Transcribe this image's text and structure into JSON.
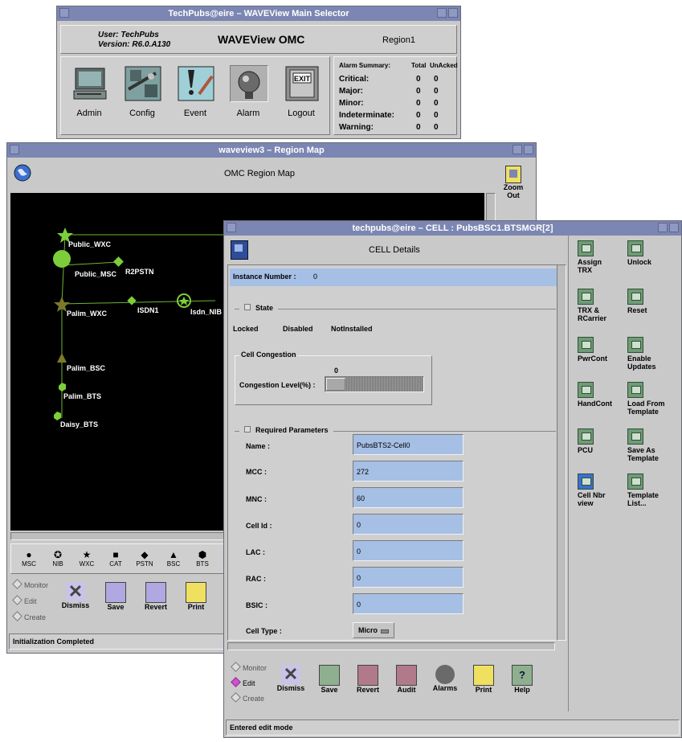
{
  "main_selector": {
    "title": "TechPubs@eire – WAVEView Main Selector",
    "user": "User: TechPubs",
    "version": "Version: R6.0.A130",
    "app_title": "WAVEView OMC",
    "region": "Region1",
    "tools": [
      {
        "label": "Admin",
        "icon": "computer-icon"
      },
      {
        "label": "Config",
        "icon": "config-icon"
      },
      {
        "label": "Event",
        "icon": "event-icon"
      },
      {
        "label": "Alarm",
        "icon": "alarm-bell-icon"
      },
      {
        "label": "Logout",
        "icon": "exit-door-icon",
        "icon_text": "EXIT"
      }
    ],
    "alarm_summary": {
      "header": "Alarm Summary:",
      "col_total": "Total",
      "col_unacked": "UnAcked",
      "rows": [
        {
          "label": "Critical:",
          "total": "0",
          "unacked": "0"
        },
        {
          "label": "Major:",
          "total": "0",
          "unacked": "0"
        },
        {
          "label": "Minor:",
          "total": "0",
          "unacked": "0"
        },
        {
          "label": "Indeterminate:",
          "total": "0",
          "unacked": "0"
        },
        {
          "label": "Warning:",
          "total": "0",
          "unacked": "0"
        }
      ]
    }
  },
  "region_map": {
    "title": "waveview3 – Region Map",
    "header": "OMC Region Map",
    "zoom_out_label": "Zoom\nOut",
    "nodes": {
      "public_wxc": "Public_WXC",
      "public_msc": "Public_MSC",
      "r2pstn": "R2PSTN",
      "palim_wxc": "Palim_WXC",
      "isdn1": "ISDN1",
      "isdn_nib": "Isdn_NIB",
      "palim_bsc": "Palim_BSC",
      "palim_bts": "Palim_BTS",
      "daisy_bts": "Daisy_BTS"
    },
    "legend": [
      {
        "sym": "●",
        "label": "MSC"
      },
      {
        "sym": "✪",
        "label": "NIB"
      },
      {
        "sym": "★",
        "label": "WXC"
      },
      {
        "sym": "■",
        "label": "CAT"
      },
      {
        "sym": "◆",
        "label": "PSTN"
      },
      {
        "sym": "▲",
        "label": "BSC"
      },
      {
        "sym": "⬢",
        "label": "BTS"
      }
    ],
    "modes": {
      "monitor": "Monitor",
      "edit": "Edit",
      "create": "Create"
    },
    "actions": {
      "dismiss": "Dismiss",
      "save": "Save",
      "revert": "Revert",
      "print": "Print"
    },
    "status": "Initialization Completed"
  },
  "cell_window": {
    "title": "techpubs@eire – CELL : PubsBSC1.BTSMGR[2]",
    "header": "CELL Details",
    "instance_label": "Instance Number :",
    "instance_value": "0",
    "state_label": "State",
    "state_values": [
      "Locked",
      "Disabled",
      "NotInstalled"
    ],
    "congestion_group": "Cell Congestion",
    "congestion_value": "0",
    "congestion_label": "Congestion Level(%) :",
    "congestion_level": 0.0,
    "required_label": "Required Parameters",
    "fields": [
      {
        "label": "Name :",
        "value": "PubsBTS2-Cell0"
      },
      {
        "label": "MCC :",
        "value": "272"
      },
      {
        "label": "MNC :",
        "value": "60"
      },
      {
        "label": "Cell Id :",
        "value": "0"
      },
      {
        "label": "LAC :",
        "value": "0"
      },
      {
        "label": "RAC :",
        "value": "0"
      },
      {
        "label": "BSIC :",
        "value": "0"
      }
    ],
    "cell_type_label": "Cell Type :",
    "cell_type_value": "Micro",
    "side_buttons": [
      {
        "label": "Assign\nTRX"
      },
      {
        "label": "Unlock"
      },
      {
        "label": "TRX &\nRCarrier"
      },
      {
        "label": "Reset"
      },
      {
        "label": "PwrCont"
      },
      {
        "label": "Enable\nUpdates"
      },
      {
        "label": "HandCont"
      },
      {
        "label": "Load From\nTemplate"
      },
      {
        "label": "PCU"
      },
      {
        "label": "Save As\nTemplate"
      },
      {
        "label": "Cell Nbr\nview"
      },
      {
        "label": "Template\nList..."
      }
    ],
    "modes": {
      "monitor": "Monitor",
      "edit": "Edit",
      "create": "Create"
    },
    "actions": {
      "dismiss": "Dismiss",
      "save": "Save",
      "revert": "Revert",
      "audit": "Audit",
      "alarms": "Alarms",
      "print": "Print",
      "help": "Help"
    },
    "status": "Entered edit mode"
  },
  "colors": {
    "titlebar": "#7b86b2",
    "window_bg": "#c9c9c9",
    "field_bg": "#a6bfe5",
    "map_bg": "#000000",
    "node_green": "#7ccf3a",
    "node_olive": "#7a7a2a"
  }
}
